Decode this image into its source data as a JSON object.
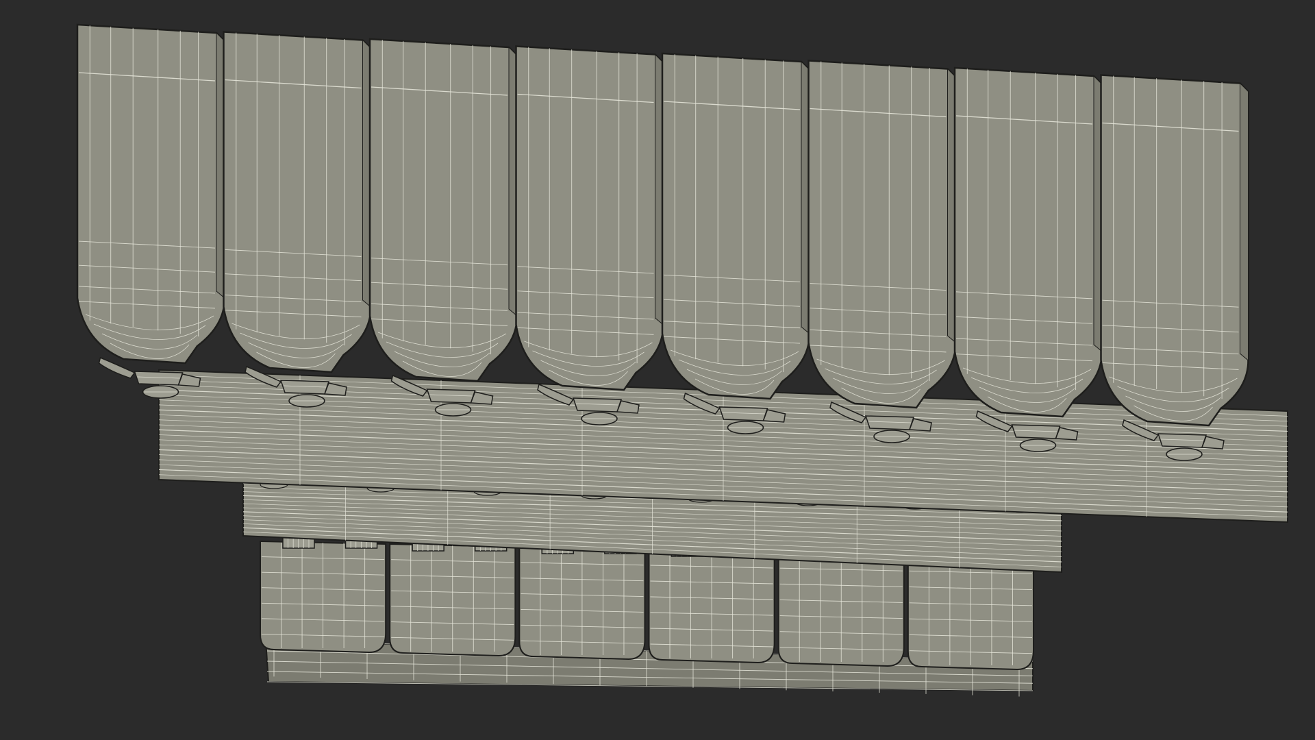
{
  "scene": {
    "subject": "wireframe-render",
    "colors": {
      "background": "#2b2b2b",
      "surface": "#8f8f83",
      "surface_dark": "#7c7c71",
      "surface_light": "#9d9d91",
      "wire": "#e8e8dc",
      "edge": "#1e1e1c"
    },
    "dispenser_count": 8,
    "lower_module_count": 6
  }
}
